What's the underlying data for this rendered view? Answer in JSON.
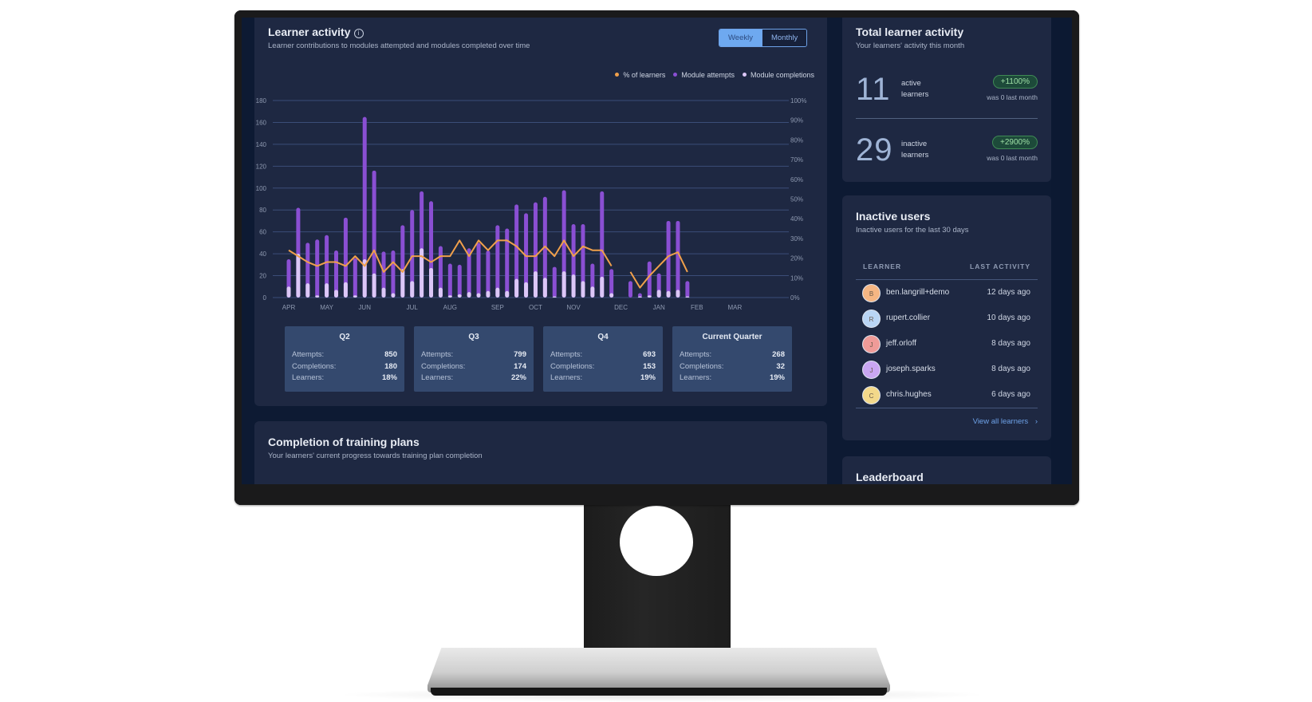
{
  "colors": {
    "attempts": "#8a4fd3",
    "completions": "#dcc7f7",
    "learners_line": "#f0a04b",
    "grid": "#3b4d78",
    "badge_green": "#9fe0a6",
    "link": "#6ea2e8"
  },
  "learner_activity": {
    "title": "Learner activity",
    "info_icon": "info-circle-icon",
    "subtitle": "Learner contributions to modules attempted and modules completed over time",
    "toggle": {
      "weekly": "Weekly",
      "monthly": "Monthly",
      "selected": "Weekly"
    },
    "legend": [
      {
        "label": "% of learners",
        "color": "#f0a04b"
      },
      {
        "label": "Module attempts",
        "color": "#8a4fd3"
      },
      {
        "label": "Module completions",
        "color": "#dcc7f7"
      }
    ],
    "quarters": [
      {
        "title": "Q2",
        "attempts_label": "Attempts:",
        "attempts": "850",
        "completions_label": "Completions:",
        "completions": "180",
        "learners_label": "Learners:",
        "learners": "18%"
      },
      {
        "title": "Q3",
        "attempts_label": "Attempts:",
        "attempts": "799",
        "completions_label": "Completions:",
        "completions": "174",
        "learners_label": "Learners:",
        "learners": "22%"
      },
      {
        "title": "Q4",
        "attempts_label": "Attempts:",
        "attempts": "693",
        "completions_label": "Completions:",
        "completions": "153",
        "learners_label": "Learners:",
        "learners": "19%"
      },
      {
        "title": "Current Quarter",
        "attempts_label": "Attempts:",
        "attempts": "268",
        "completions_label": "Completions:",
        "completions": "32",
        "learners_label": "Learners:",
        "learners": "19%"
      }
    ]
  },
  "chart_data": {
    "type": "bar",
    "title": "Learner activity",
    "xlabel": "",
    "ylabel": "",
    "grid": true,
    "legend_position": "top-right",
    "x_count": 52,
    "month_ticks": [
      {
        "label": "APR",
        "index": 0
      },
      {
        "label": "MAY",
        "index": 4
      },
      {
        "label": "JUN",
        "index": 8
      },
      {
        "label": "JUL",
        "index": 13
      },
      {
        "label": "AUG",
        "index": 17
      },
      {
        "label": "SEP",
        "index": 22
      },
      {
        "label": "OCT",
        "index": 26
      },
      {
        "label": "NOV",
        "index": 30
      },
      {
        "label": "DEC",
        "index": 35
      },
      {
        "label": "JAN",
        "index": 39
      },
      {
        "label": "FEB",
        "index": 43
      },
      {
        "label": "MAR",
        "index": 47
      }
    ],
    "ylim": [
      0,
      180
    ],
    "yticks": [
      0,
      20,
      40,
      60,
      80,
      100,
      120,
      140,
      160,
      180
    ],
    "y2lim": [
      0,
      100
    ],
    "y2ticks": [
      "0%",
      "10%",
      "20%",
      "30%",
      "40%",
      "50%",
      "60%",
      "70%",
      "80%",
      "90%",
      "100%"
    ],
    "series": [
      {
        "name": "Module attempts",
        "type": "bar",
        "axis": "left",
        "values": [
          35,
          82,
          50,
          53,
          57,
          43,
          73,
          36,
          165,
          116,
          42,
          43,
          66,
          80,
          97,
          88,
          47,
          31,
          30,
          45,
          50,
          43,
          66,
          63,
          85,
          77,
          87,
          92,
          28,
          98,
          67,
          67,
          31,
          97,
          26,
          0,
          15,
          4,
          33,
          22,
          70,
          70,
          15
        ]
      },
      {
        "name": "Module completions",
        "type": "bar",
        "axis": "left",
        "values": [
          10,
          40,
          13,
          2,
          13,
          7,
          14,
          2,
          35,
          22,
          9,
          4,
          26,
          15,
          45,
          27,
          9,
          2,
          3,
          5,
          4,
          6,
          9,
          6,
          17,
          14,
          24,
          18,
          1,
          24,
          21,
          15,
          10,
          19,
          4,
          0,
          0,
          1,
          2,
          7,
          6,
          7,
          1
        ]
      },
      {
        "name": "% of learners",
        "type": "line",
        "axis": "right",
        "values": [
          24,
          21,
          18,
          16,
          18,
          18,
          16,
          21,
          16,
          24,
          13,
          18,
          13,
          21,
          21,
          18,
          21,
          21,
          29,
          21,
          29,
          24,
          29,
          29,
          26,
          21,
          21,
          26,
          21,
          29,
          21,
          26,
          24,
          24,
          16,
          null,
          13,
          5,
          11,
          16,
          21,
          23,
          13
        ]
      }
    ]
  },
  "completion": {
    "title": "Completion of training plans",
    "subtitle": "Your learners' current progress towards training plan completion"
  },
  "total_activity": {
    "title": "Total learner activity",
    "subtitle": "Your learners' activity this month",
    "stats": [
      {
        "value": "11",
        "label_line1": "active",
        "label_line2": "learners",
        "badge": "+1100%",
        "note": "was 0 last month"
      },
      {
        "value": "29",
        "label_line1": "inactive",
        "label_line2": "learners",
        "badge": "+2900%",
        "note": "was 0 last month"
      }
    ]
  },
  "inactive_users": {
    "title": "Inactive users",
    "subtitle": "Inactive users for the last 30 days",
    "columns": [
      "LEARNER",
      "LAST ACTIVITY"
    ],
    "rows": [
      {
        "initial": "B",
        "name": "ben.langrill+demo",
        "last_activity": "12 days ago",
        "color": "#f5b683"
      },
      {
        "initial": "R",
        "name": "rupert.collier",
        "last_activity": "10 days ago",
        "color": "#b9d5f5"
      },
      {
        "initial": "J",
        "name": "jeff.orloff",
        "last_activity": "8 days ago",
        "color": "#ef9b98"
      },
      {
        "initial": "J",
        "name": "joseph.sparks",
        "last_activity": "8 days ago",
        "color": "#c9a6f2"
      },
      {
        "initial": "C",
        "name": "chris.hughes",
        "last_activity": "6 days ago",
        "color": "#f3d88a"
      }
    ],
    "view_all": "View all learners",
    "view_all_icon": "chevron-right-icon"
  },
  "leaderboard": {
    "title": "Leaderboard"
  }
}
